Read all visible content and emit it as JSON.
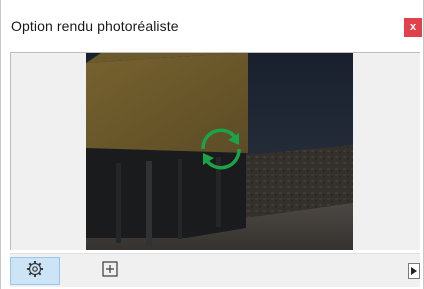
{
  "window": {
    "title": "Option rendu photoréaliste",
    "close_label": "x",
    "close_color": "#e0414a"
  },
  "preview": {
    "status": "rendering",
    "spinner_color": "#1aa34a"
  },
  "toolbar": {
    "buttons": [
      {
        "name": "settings",
        "icon": "gear-icon",
        "active": true
      },
      {
        "name": "frame",
        "icon": "crop-frame-icon",
        "active": false
      }
    ],
    "expand_icon": "triangle-right-icon"
  }
}
